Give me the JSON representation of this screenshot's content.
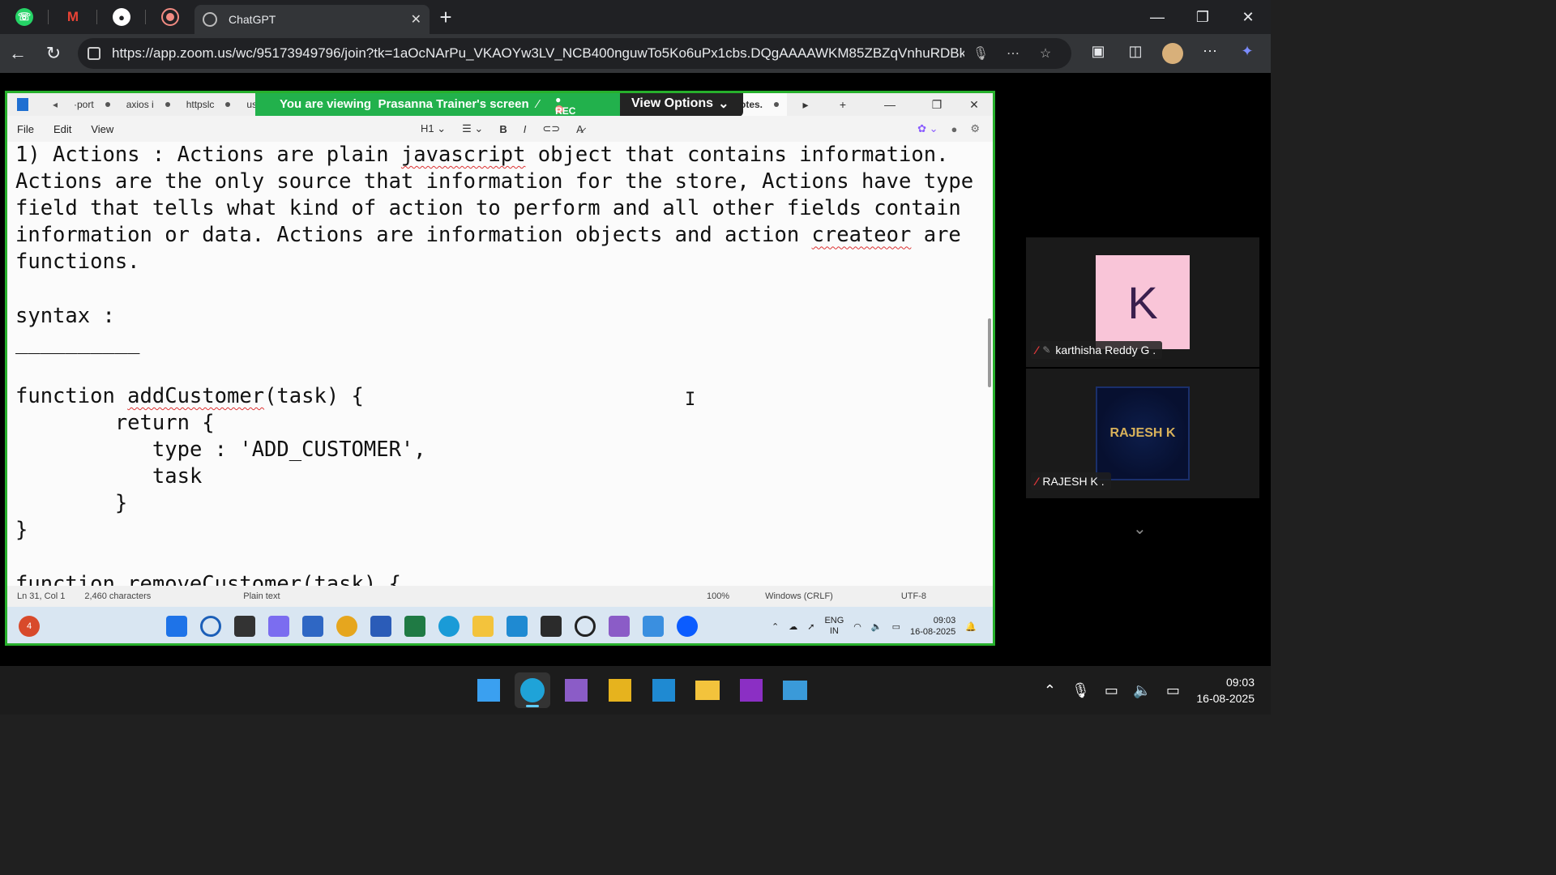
{
  "browser": {
    "active_tab_title": "ChatGPT",
    "tab_close": "✕",
    "new_tab": "+",
    "url": "https://app.zoom.us/wc/95173949796/join?tk=1aOcNArPu_VKAOYw3LV_NCB400nguwTo5Ko6uPx1cbs.DQgAAAAWKM85ZBZqVnhuRDBk...",
    "window_controls": {
      "minimize": "—",
      "restore": "❐",
      "close": "✕"
    }
  },
  "zoom": {
    "banner_prefix": "You are viewing",
    "banner_name": "Prasanna Trainer's screen",
    "rec_label": "REC",
    "view_options": "View Options",
    "participants": [
      {
        "name": "karthisha Reddy G .",
        "initial": "K"
      },
      {
        "name": "RAJESH K .",
        "avatar_text": "RAJESH K"
      }
    ]
  },
  "notepad": {
    "tabs": [
      "·port",
      "axios i",
      "httpslc",
      "us"
    ],
    "right_tab": "notes.",
    "menu": [
      "File",
      "Edit",
      "View"
    ],
    "heading_select": "H1",
    "content_lines": [
      "1) Actions : Actions are plain ",
      "javascript",
      " object that contains information. Actions are the only source that information for the store, Actions have type field that tells what kind of action to perform and all other fields contain information or data. Actions are information objects and action ",
      "createor",
      " are functions.\n\nsyntax :\n__________\n\nfunction ",
      "addCustomer",
      "(task) {\n        return {\n           type : 'ADD_CUSTOMER',\n           task\n        }\n}\n\nfunction removeCustomer(task) {"
    ],
    "status": {
      "position": "Ln 31, Col 1",
      "chars": "2,460 characters",
      "mode": "Plain text",
      "zoom": "100%",
      "line_ending": "Windows (CRLF)",
      "encoding": "UTF-8"
    }
  },
  "remote_taskbar": {
    "lang_top": "ENG",
    "lang_bottom": "IN",
    "time": "09:03",
    "date": "16-08-2025",
    "badge": "4"
  },
  "taskbar": {
    "time": "09:03",
    "date": "16-08-2025"
  },
  "colors": {
    "share_border": "#27b02c",
    "banner_bg": "#22b14c"
  }
}
